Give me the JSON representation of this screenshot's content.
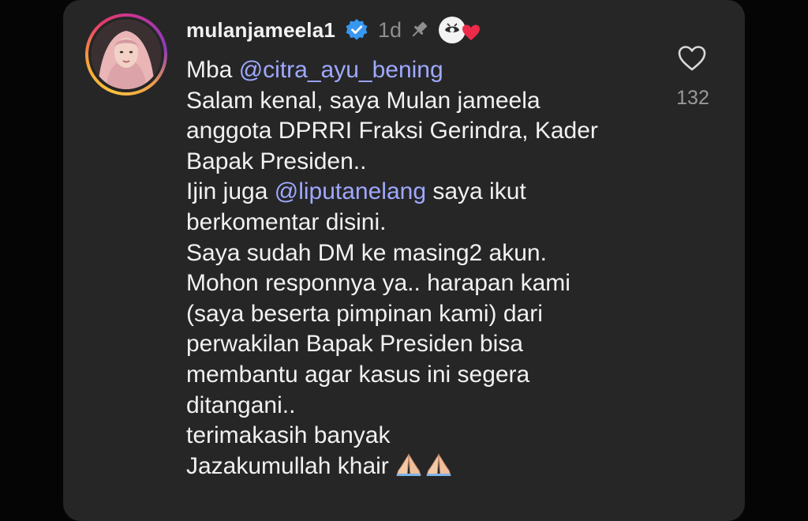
{
  "comment": {
    "username": "mulanjameela1",
    "time": "1d",
    "lines": [
      {
        "parts": [
          {
            "text": "Mba "
          },
          {
            "text": "@citra_ayu_bening",
            "mention": true
          }
        ]
      },
      {
        "parts": [
          {
            "text": "Salam kenal, saya Mulan  jameela"
          }
        ]
      },
      {
        "parts": [
          {
            "text": "anggota DPRRI Fraksi Gerindra, Kader"
          }
        ]
      },
      {
        "parts": [
          {
            "text": "Bapak Presiden.."
          }
        ]
      },
      {
        "parts": [
          {
            "text": "Ijin juga "
          },
          {
            "text": "@liputanelang",
            "mention": true
          },
          {
            "text": " saya ikut"
          }
        ]
      },
      {
        "parts": [
          {
            "text": "berkomentar disini."
          }
        ]
      },
      {
        "parts": [
          {
            "text": "Saya sudah DM ke masing2 akun."
          }
        ]
      },
      {
        "parts": [
          {
            "text": "Mohon responnya ya.. harapan kami"
          }
        ]
      },
      {
        "parts": [
          {
            "text": "(saya beserta pimpinan kami) dari"
          }
        ]
      },
      {
        "parts": [
          {
            "text": "perwakilan Bapak Presiden bisa"
          }
        ]
      },
      {
        "parts": [
          {
            "text": "membantu agar kasus ini segera"
          }
        ]
      },
      {
        "parts": [
          {
            "text": "ditangani.."
          }
        ]
      },
      {
        "parts": [
          {
            "text": "terimakasih banyak"
          }
        ]
      },
      {
        "parts": [
          {
            "text": "Jazakumullah khair"
          }
        ],
        "emoji": "folded-hands-icon"
      }
    ]
  },
  "like": {
    "count": "132",
    "icon": "heart-outline-icon"
  },
  "icons": {
    "verified": "verified-badge-icon",
    "pin": "pin-icon",
    "creator_badge": "creator-heart-badge-icon"
  },
  "colors": {
    "card_background": "#262627",
    "page_background": "#050505",
    "mention": "#9fa9ff",
    "verified": "#3897f0",
    "heart_badge": "#ed2b49"
  }
}
